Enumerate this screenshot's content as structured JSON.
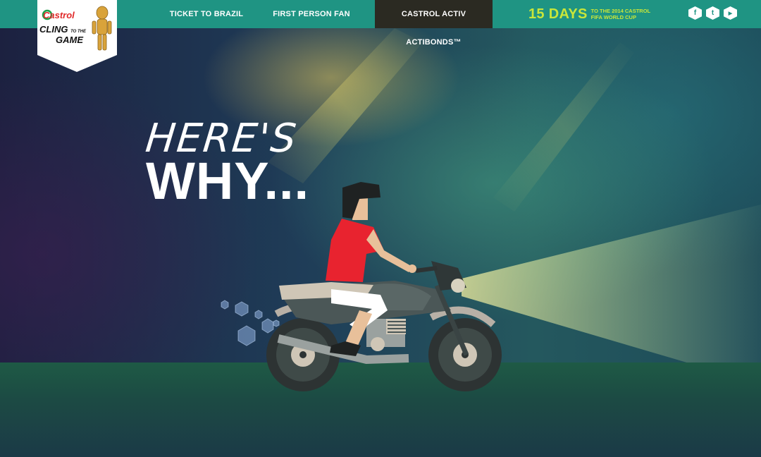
{
  "nav": {
    "items": [
      {
        "label": "TICKET TO BRAZIL",
        "active": false
      },
      {
        "label": "FIRST PERSON FAN",
        "active": false
      },
      {
        "label": "CASTROL ACTIV ACTIBONDS™",
        "active": true
      }
    ],
    "countdown_big": "15 DAYS",
    "countdown_small": "TO THE 2014 CASTROL FIFA WORLD CUP",
    "social": [
      {
        "icon": "facebook-icon",
        "glyph": "f"
      },
      {
        "icon": "twitter-icon",
        "glyph": "t"
      },
      {
        "icon": "youtube-icon",
        "glyph": "▶"
      }
    ]
  },
  "logo": {
    "brand": "Castrol",
    "line1": "CLING",
    "line1_small": "TO THE",
    "line2": "GAME"
  },
  "hero": {
    "headline_line1": "HERE'S",
    "headline_line2": "WHY..."
  },
  "colors": {
    "nav_bg": "#1f9483",
    "nav_active_bg": "#2b2a22",
    "countdown": "#c8e63a",
    "brand_red": "#e02a2a"
  }
}
